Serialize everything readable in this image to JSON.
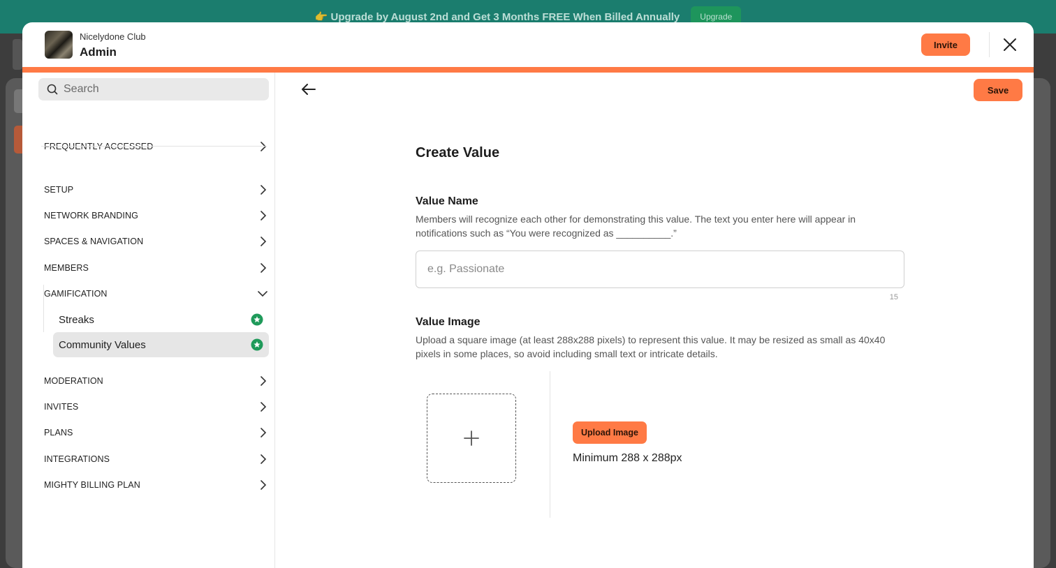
{
  "banner": {
    "text": "👉 Upgrade by August 2nd and Get 3 Months FREE When Billed Annually",
    "button_label": "Upgrade"
  },
  "header": {
    "club_name": "Nicelydone Club",
    "role": "Admin",
    "invite_label": "Invite"
  },
  "sidebar": {
    "search_placeholder": "Search",
    "items": [
      {
        "label": "FREQUENTLY ACCESSED"
      },
      {
        "label": "SETUP"
      },
      {
        "label": "NETWORK BRANDING"
      },
      {
        "label": "SPACES & NAVIGATION"
      },
      {
        "label": "MEMBERS"
      },
      {
        "label": "GAMIFICATION",
        "expanded": true
      },
      {
        "label": "MODERATION"
      },
      {
        "label": "INVITES"
      },
      {
        "label": "PLANS"
      },
      {
        "label": "INTEGRATIONS"
      },
      {
        "label": "MIGHTY BILLING PLAN"
      }
    ],
    "gamification_subitems": [
      {
        "label": "Streaks",
        "badge_icon": "star-badge-icon"
      },
      {
        "label": "Community Values",
        "badge_icon": "star-badge-icon",
        "active": true
      }
    ]
  },
  "main": {
    "save_label": "Save",
    "title": "Create Value",
    "value_name": {
      "label": "Value Name",
      "description": "Members will recognize each other for demonstrating this value. The text you enter here will appear in notifications such as “You were recognized as __________.”",
      "placeholder": "e.g. Passionate",
      "char_limit": "15"
    },
    "value_image": {
      "label": "Value Image",
      "description": "Upload a square image (at least 288x288 pixels) to represent this value. It may be resized as small as 40x40 pixels in some places, so avoid including small text or intricate details.",
      "upload_label": "Upload Image",
      "hint": "Minimum 288 x 288px"
    }
  },
  "colors": {
    "accent": "#ff7a45",
    "badge_green": "#1f9a5a",
    "banner_bg": "#1b7d6e"
  }
}
